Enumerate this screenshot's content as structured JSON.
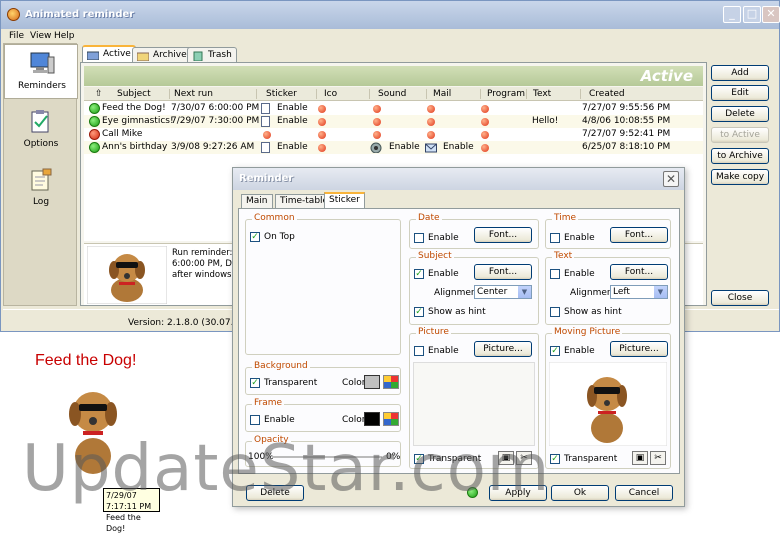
{
  "window": {
    "title": "Animated reminder"
  },
  "menu": [
    "File",
    "View",
    "Help"
  ],
  "sidebar": {
    "items": [
      {
        "label": "Reminders",
        "icon": "monitor-icon"
      },
      {
        "label": "Options",
        "icon": "clipboard-icon"
      },
      {
        "label": "Log",
        "icon": "notepad-icon"
      }
    ]
  },
  "tabs": {
    "active": "Active",
    "archive": "Archive",
    "trash": "Trash"
  },
  "banner": "Active",
  "grid": {
    "columns": [
      "Subject",
      "Next run",
      "Sticker",
      "Ico",
      "Sound",
      "Mail",
      "Program",
      "Text",
      "Created"
    ],
    "rows": [
      {
        "subject": "Feed the Dog!",
        "next_run": "7/30/07 6:00:00 PM",
        "sticker": "Enable",
        "sound": "",
        "mail": "",
        "text": "",
        "created": "7/27/07 9:55:56 PM",
        "status": "green"
      },
      {
        "subject": "Eye gimnastics!",
        "next_run": "7/29/07 7:30:00 PM",
        "sticker": "Enable",
        "sound": "",
        "mail": "",
        "text": "Hello!",
        "created": "4/8/06 10:08:55 PM",
        "status": "green"
      },
      {
        "subject": "Call Mike",
        "next_run": "",
        "sticker": "",
        "sound": "",
        "mail": "",
        "text": "",
        "created": "7/27/07 9:52:41 PM",
        "status": "red"
      },
      {
        "subject": "Ann's birthday",
        "next_run": "3/9/08 9:27:26 AM",
        "sticker": "Enable",
        "sound": "Enable",
        "mail": "Enable",
        "text": "",
        "created": "6/25/07 8:18:10 PM",
        "status": "green"
      }
    ]
  },
  "preview": {
    "line1": "Run reminder: da",
    "line2": "6:00:00 PM, Dura",
    "line3": "after windows sta"
  },
  "buttons": {
    "add": "Add",
    "edit": "Edit",
    "delete": "Delete",
    "to_active": "to Active",
    "to_archive": "to Archive",
    "make_copy": "Make copy",
    "close": "Close"
  },
  "status": "Version: 2.1.8.0 (30.07.07)",
  "dialog": {
    "title": "Reminder",
    "tabs": [
      "Main",
      "Time-table",
      "Sticker"
    ],
    "common": {
      "title": "Common",
      "on_top": "On Top"
    },
    "background": {
      "title": "Background",
      "transparent": "Transparent",
      "color": "Color:",
      "swatch": "#c0c0c0"
    },
    "frame": {
      "title": "Frame",
      "enable": "Enable",
      "color": "Color:",
      "swatch": "#000000"
    },
    "opacity": {
      "title": "Opacity",
      "left": "100%",
      "right": "0%"
    },
    "date": {
      "title": "Date",
      "enable": "Enable",
      "font": "Font..."
    },
    "time": {
      "title": "Time",
      "enable": "Enable",
      "font": "Font..."
    },
    "subject": {
      "title": "Subject",
      "enable": "Enable",
      "font": "Font...",
      "alignment": "Alignment",
      "align_value": "Center",
      "hint": "Show as hint"
    },
    "text": {
      "title": "Text",
      "enable": "Enable",
      "font": "Font...",
      "alignment": "Alignment",
      "align_value": "Left",
      "hint": "Show as hint"
    },
    "picture": {
      "title": "Picture",
      "enable": "Enable",
      "button": "Picture...",
      "transparent": "Transparent"
    },
    "moving": {
      "title": "Moving Picture",
      "enable": "Enable",
      "button": "Picture...",
      "transparent": "Transparent"
    },
    "footer": {
      "delete": "Delete",
      "apply": "Apply",
      "ok": "Ok",
      "cancel": "Cancel"
    }
  },
  "sticker_demo": {
    "title": "Feed the Dog!",
    "tooltip_time": "7/29/07 7:17:11 PM",
    "tooltip_text": "Feed the Dog!"
  },
  "watermark": "UpdateStar.com"
}
